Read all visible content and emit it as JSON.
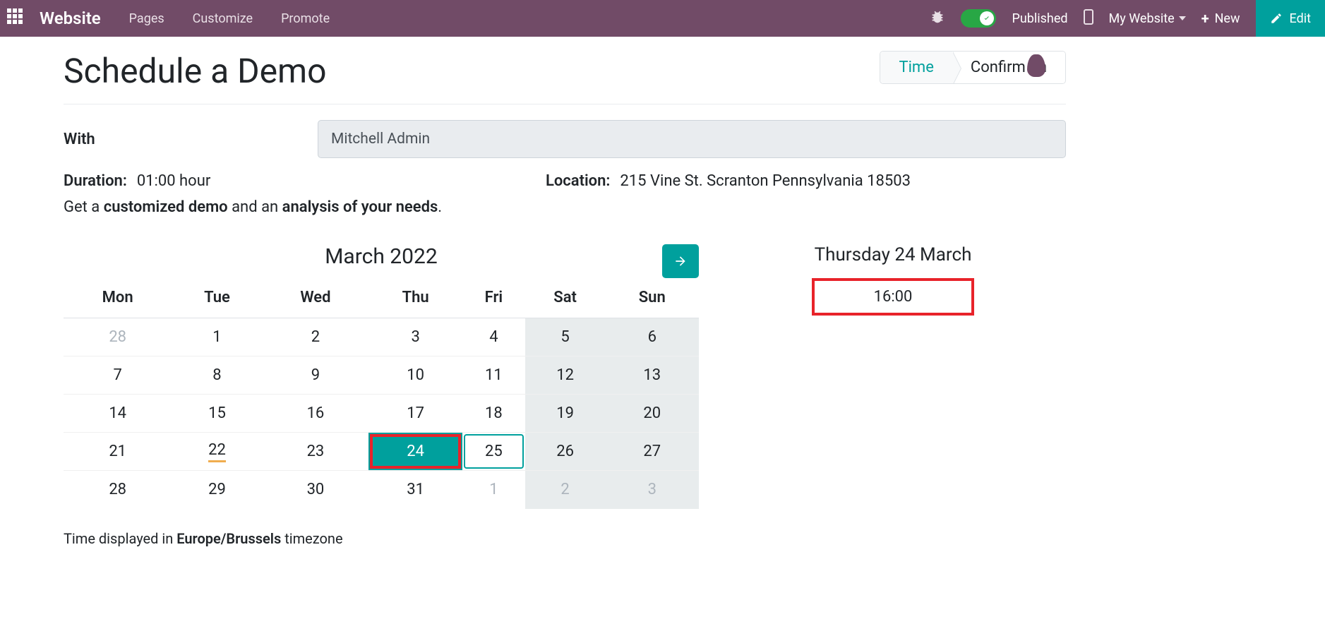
{
  "topbar": {
    "brand": "Website",
    "nav": {
      "pages": "Pages",
      "customize": "Customize",
      "promote": "Promote"
    },
    "published": "Published",
    "my_website": "My Website",
    "new": "New",
    "edit": "Edit"
  },
  "page": {
    "title": "Schedule a Demo",
    "wizard": {
      "step1": "Time",
      "step2": "Confirm      on"
    }
  },
  "form": {
    "with_label": "With",
    "with_value": "Mitchell Admin",
    "duration_label": "Duration:",
    "duration_value": "01:00 hour",
    "location_label": "Location:",
    "location_value": "215 Vine St. Scranton Pennsylvania 18503",
    "desc_prefix": "Get a ",
    "desc_bold1": "customized demo",
    "desc_mid": " and an ",
    "desc_bold2": "analysis of your needs",
    "desc_suffix": "."
  },
  "calendar": {
    "month_label": "March 2022",
    "dow": {
      "mon": "Mon",
      "tue": "Tue",
      "wed": "Wed",
      "thu": "Thu",
      "fri": "Fri",
      "sat": "Sat",
      "sun": "Sun"
    },
    "weeks": [
      [
        {
          "n": "28",
          "muted": true
        },
        {
          "n": "1"
        },
        {
          "n": "2"
        },
        {
          "n": "3"
        },
        {
          "n": "4"
        },
        {
          "n": "5",
          "weekend": true
        },
        {
          "n": "6",
          "weekend": true
        }
      ],
      [
        {
          "n": "7"
        },
        {
          "n": "8"
        },
        {
          "n": "9"
        },
        {
          "n": "10"
        },
        {
          "n": "11"
        },
        {
          "n": "12",
          "weekend": true
        },
        {
          "n": "13",
          "weekend": true
        }
      ],
      [
        {
          "n": "14"
        },
        {
          "n": "15"
        },
        {
          "n": "16"
        },
        {
          "n": "17"
        },
        {
          "n": "18"
        },
        {
          "n": "19",
          "weekend": true
        },
        {
          "n": "20",
          "weekend": true
        }
      ],
      [
        {
          "n": "21"
        },
        {
          "n": "22",
          "today": true
        },
        {
          "n": "23"
        },
        {
          "n": "24",
          "selected": true
        },
        {
          "n": "25",
          "available": true
        },
        {
          "n": "26",
          "weekend": true
        },
        {
          "n": "27",
          "weekend": true
        }
      ],
      [
        {
          "n": "28"
        },
        {
          "n": "29"
        },
        {
          "n": "30"
        },
        {
          "n": "31"
        },
        {
          "n": "1",
          "muted": true
        },
        {
          "n": "2",
          "muted": true,
          "weekend": true
        },
        {
          "n": "3",
          "muted": true,
          "weekend": true
        }
      ]
    ],
    "tz_prefix": "Time displayed in ",
    "tz_value": "Europe/Brussels",
    "tz_suffix": " timezone"
  },
  "slots": {
    "title": "Thursday 24 March",
    "time1": "16:00"
  }
}
